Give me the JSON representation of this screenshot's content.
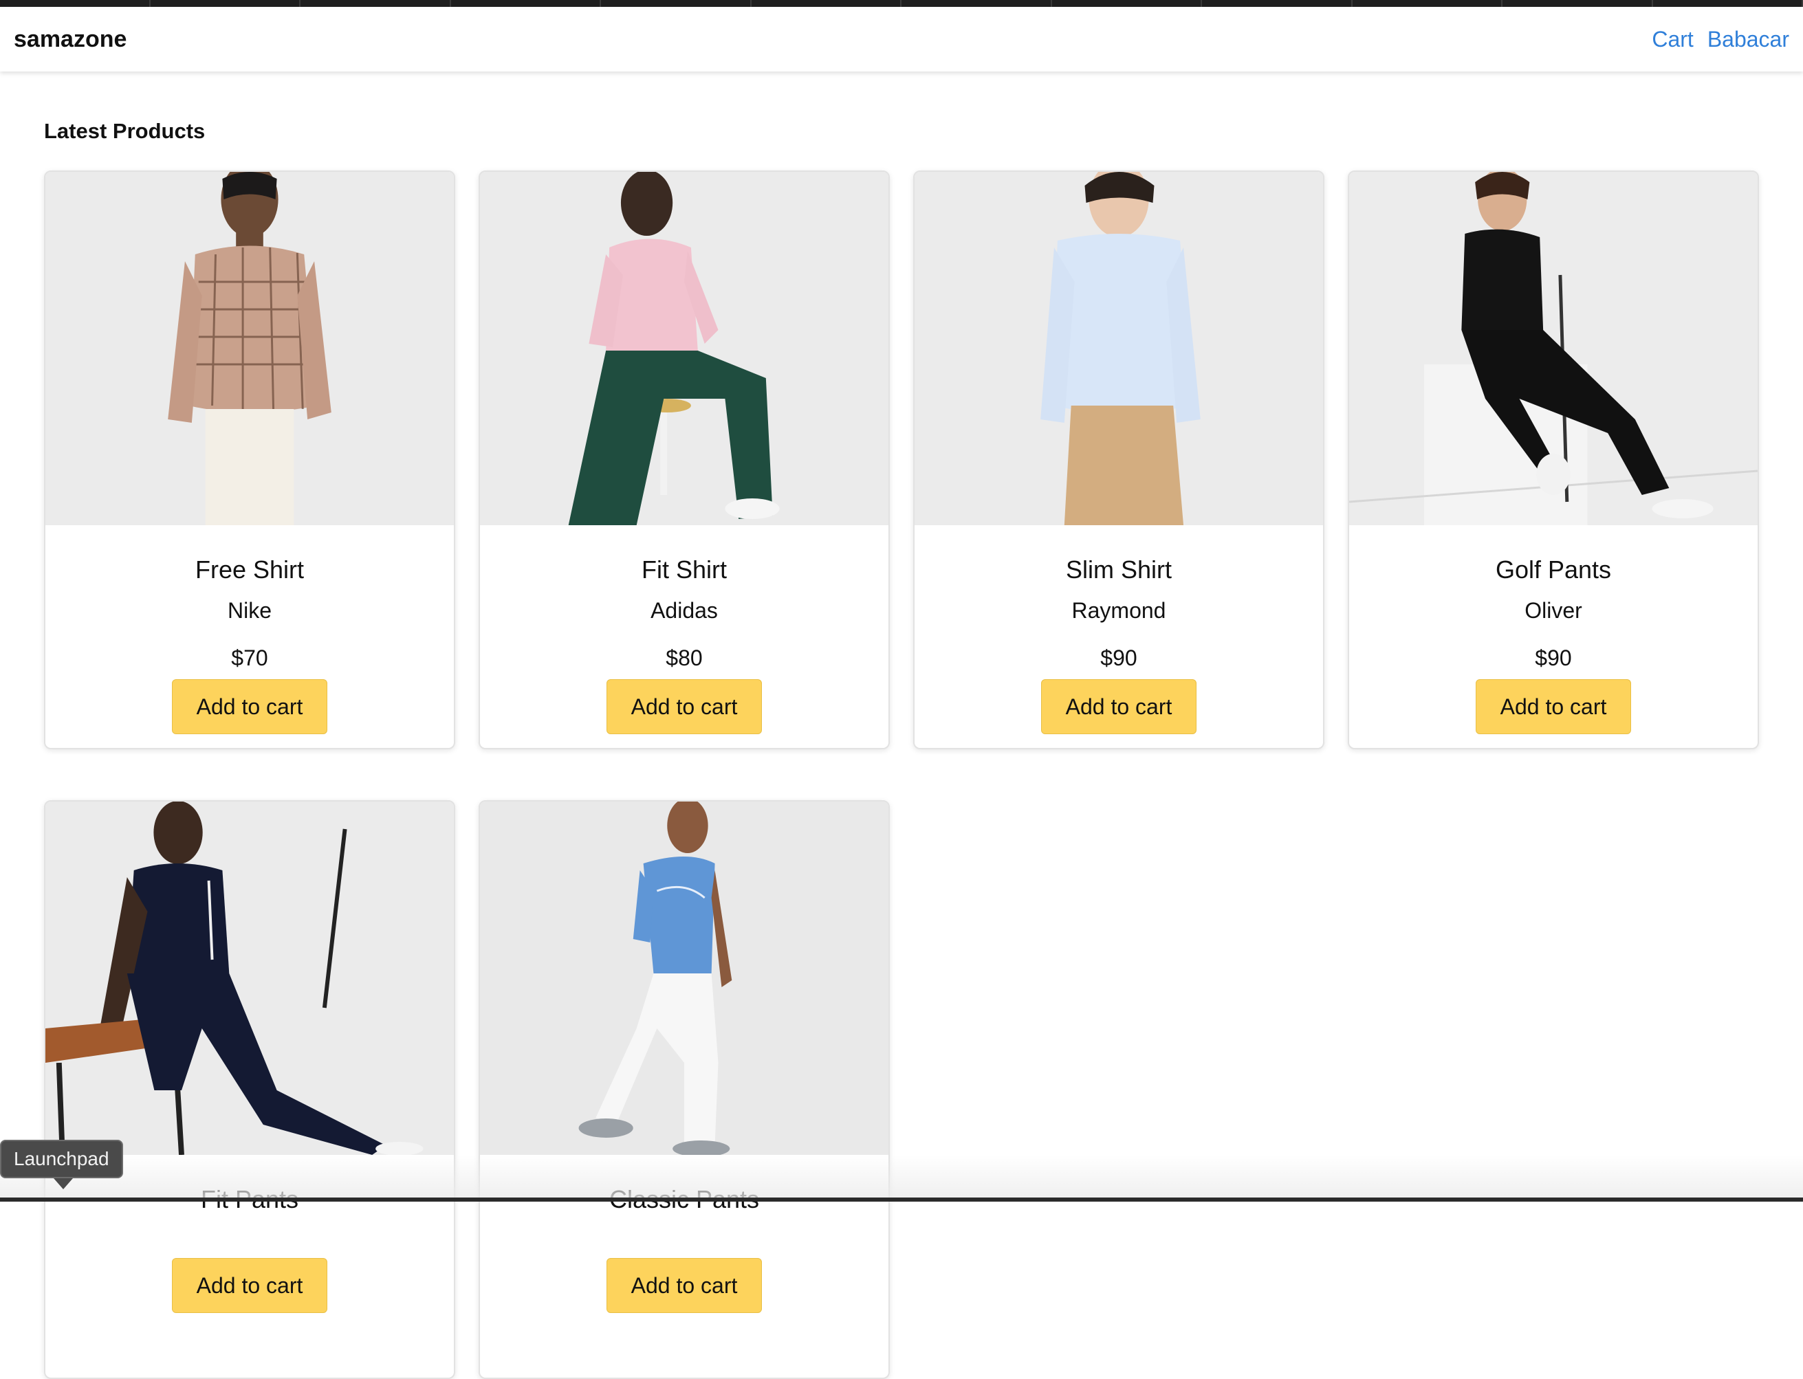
{
  "navbar": {
    "brand": "samazone",
    "links": [
      "Cart",
      "Babacar"
    ]
  },
  "main": {
    "section_title": "Latest Products",
    "add_button_label": "Add to cart",
    "products": [
      {
        "name": "Free Shirt",
        "brand": "Nike",
        "price": "$70"
      },
      {
        "name": "Fit Shirt",
        "brand": "Adidas",
        "price": "$80"
      },
      {
        "name": "Slim Shirt",
        "brand": "Raymond",
        "price": "$90"
      },
      {
        "name": "Golf Pants",
        "brand": "Oliver",
        "price": "$90"
      },
      {
        "name": "Fit Pants",
        "brand": "",
        "price": ""
      },
      {
        "name": "Classic Pants",
        "brand": "",
        "price": ""
      }
    ]
  },
  "dock_tooltip": "Launchpad",
  "colors": {
    "accent_link": "#2f7fd9",
    "button_bg": "#fdd35c"
  }
}
